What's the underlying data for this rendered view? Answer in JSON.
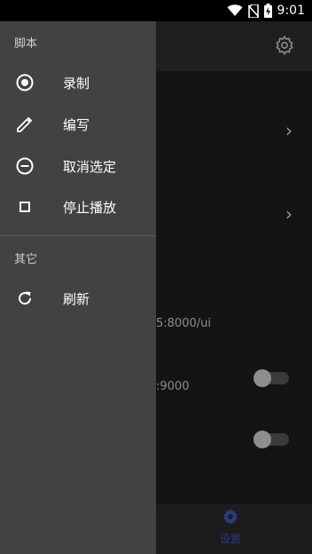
{
  "status_bar": {
    "time": "9:01",
    "icons": [
      "wifi-icon",
      "no-sim-icon",
      "battery-charging-icon"
    ]
  },
  "drawer": {
    "sections": [
      {
        "header": "脚本",
        "items": [
          {
            "label": "录制",
            "icon": "record-icon"
          },
          {
            "label": "编写",
            "icon": "pencil-icon"
          },
          {
            "label": "取消选定",
            "icon": "minus-circle-icon"
          },
          {
            "label": "停止播放",
            "icon": "stop-icon"
          }
        ]
      },
      {
        "header": "其它",
        "items": [
          {
            "label": "刷新",
            "icon": "refresh-icon"
          }
        ]
      }
    ]
  },
  "background": {
    "port_text_1": "5:8000/ui",
    "port_text_2": ":9000",
    "bottom_nav_label": "设置"
  },
  "colors": {
    "drawer_bg": "#424242",
    "scrim_bg": "#141414",
    "accent": "#2c3b7a"
  }
}
